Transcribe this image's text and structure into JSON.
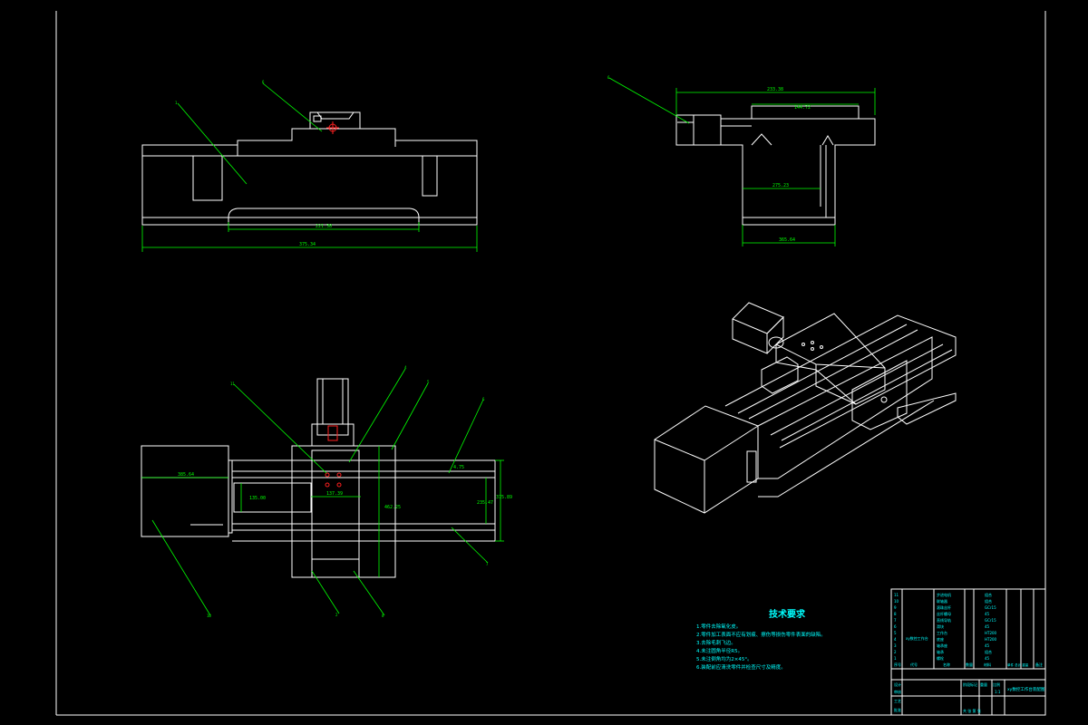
{
  "front_view": {
    "dims": {
      "overall": "375.34",
      "inner": "221.38"
    },
    "balloons": [
      "1",
      "6"
    ]
  },
  "side_view": {
    "dims": {
      "top": "233.38",
      "inner_top": "144.72",
      "mid": "275.23",
      "base": "365.64"
    },
    "balloons": [
      "6"
    ]
  },
  "top_view": {
    "dims": {
      "motor_width": "385.64",
      "width_a": "135.00",
      "width_b": "137.39",
      "height_a": "462.25",
      "height_b": "235.47",
      "height_c": "375.89",
      "gap": "4.75"
    },
    "balloons": [
      "11",
      "4",
      "5",
      "6",
      "2",
      "8",
      "7",
      "10"
    ]
  },
  "notes": {
    "title": "技术要求",
    "lines": [
      "1.零件去除氧化皮。",
      "2.零件加工表面不应有划痕、擦伤等损伤零件表面的缺陷。",
      "3.去除毛刺飞边。",
      "4.未注圆角半径R5。",
      "5.未注倒角均为2×45°。",
      "6.装配前应清洗零件并检查尺寸及精度。"
    ]
  },
  "title_block": {
    "seq_column": [
      "11",
      "10",
      "9",
      "8",
      "7",
      "6",
      "5",
      "4",
      "3",
      "2",
      "1"
    ],
    "name_column": [
      "步进电机",
      "联轴器",
      "滚珠丝杆",
      "丝杆螺母",
      "直线导轨",
      "滑块",
      "工作台",
      "底座",
      "轴承座",
      "轴承",
      "螺栓"
    ],
    "material_column": [
      "组合",
      "组合",
      "GCr15",
      "45",
      "GCr15",
      "45",
      "HT200",
      "HT200",
      "45",
      "组合",
      "45"
    ],
    "part_label": "xy数控工作台",
    "header": {
      "seq": "序号",
      "code": "代号",
      "name": "名称",
      "qty": "数量",
      "material": "材料",
      "weight": "单件 总计 重量",
      "remark": "备注"
    },
    "drawing_title": "xy数控工作台装配图",
    "designer": "设计",
    "checker": "审核",
    "process": "工艺",
    "approve": "批准",
    "stage": "阶段标记",
    "weight": "重量",
    "scale": "比例",
    "scale_value": "1:1",
    "sheet": "共 张 第 张"
  },
  "colors": {
    "background": "#000000",
    "outline": "#ffffff",
    "dimension": "#00ff00",
    "annotation": "#00ffff",
    "center_mark": "#ff2020"
  }
}
